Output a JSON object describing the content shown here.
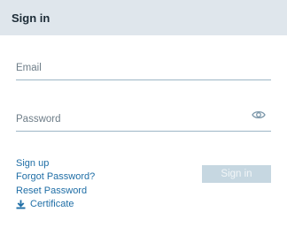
{
  "header": {
    "title": "Sign in"
  },
  "form": {
    "email": {
      "placeholder": "Email",
      "value": ""
    },
    "password": {
      "placeholder": "Password",
      "value": ""
    }
  },
  "links": {
    "sign_up": "Sign up",
    "forgot_password": "Forgot Password?",
    "reset_password": "Reset Password",
    "certificate": "Certificate"
  },
  "buttons": {
    "sign_in": "Sign in",
    "sign_in_state": "disabled"
  },
  "icons": {
    "password_visibility": "eye-icon",
    "certificate": "download-icon"
  },
  "colors": {
    "header_bg": "#dfe6ec",
    "link": "#1f6ea6",
    "field_underline": "#9db6c6",
    "button_disabled_bg": "#c6d7e1"
  }
}
